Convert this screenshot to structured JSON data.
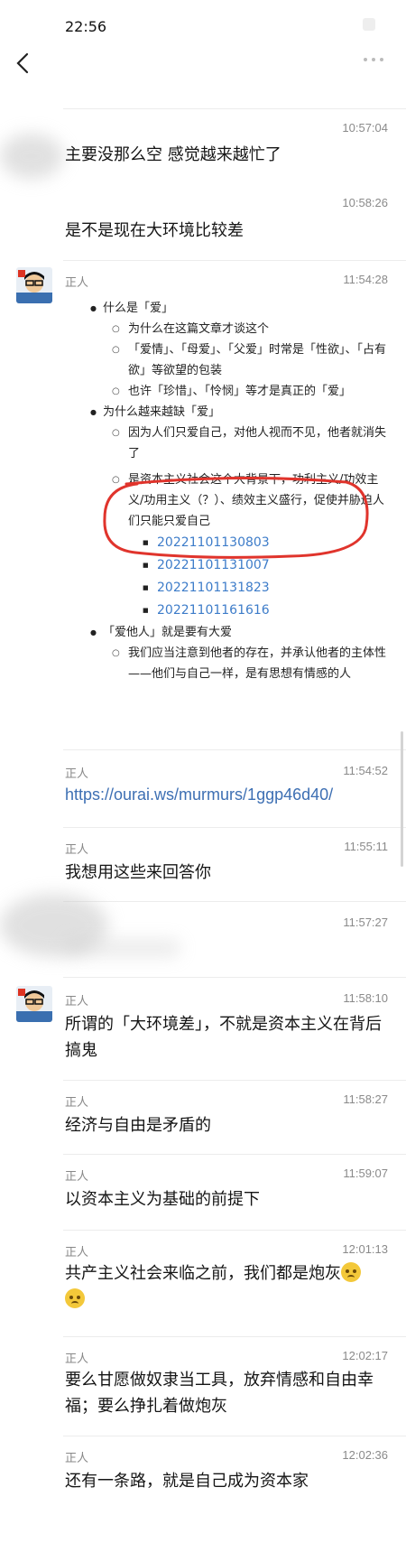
{
  "status_bar": {
    "time": "22:56"
  },
  "outline": {
    "s1": {
      "title": "什么是「爱」",
      "items": [
        "为什么在这篇文章才谈这个",
        "「爱情」、「母爱」、「父爱」时常是「性欲」、「占有欲」等欲望的包装",
        "也许「珍惜」、「怜悯」等才是真正的「爱」"
      ]
    },
    "s2": {
      "title": "为什么越来越缺「爱」",
      "items": [
        "因为人们只爱自己，对他人视而不见，他者就消失了",
        "是资本主义社会这个大背景下，功利主义/功效主义/功用主义（？）、绩效主义盛行，促使并胁迫人们只能只爱自己"
      ],
      "links": [
        "20221101130803",
        "20221101131007",
        "20221101131823",
        "20221101161616"
      ]
    },
    "s3": {
      "title": "「爱他人」就是要有大爱",
      "items": [
        "我们应当注意到他者的存在，并承认他者的主体性——他们与自己一样，是有思想有情感的人"
      ]
    }
  },
  "messages": [
    {
      "time": "10:57:04",
      "text": "主要没那么空 感觉越来越忙了"
    },
    {
      "time": "10:58:26",
      "text": "是不是现在大环境比较差"
    },
    {
      "time": "11:54:28",
      "sender": "正人"
    },
    {
      "time": "11:54:52",
      "sender": "正人",
      "text": "https://ourai.ws/murmurs/1ggp46d40/"
    },
    {
      "time": "11:55:11",
      "sender": "正人",
      "text": "我想用这些来回答你"
    },
    {
      "time": "11:57:27"
    },
    {
      "time": "11:58:10",
      "sender": "正人",
      "text": "所谓的「大环境差」，不就是资本主义在背后搞鬼"
    },
    {
      "time": "11:58:27",
      "sender": "正人",
      "text": "经济与自由是矛盾的"
    },
    {
      "time": "11:59:07",
      "sender": "正人",
      "text": "以资本主义为基础的前提下"
    },
    {
      "time": "12:01:13",
      "sender": "正人",
      "text": "共产主义社会来临之前，我们都是炮灰"
    },
    {
      "time": "12:02:17",
      "sender": "正人",
      "text": "要么甘愿做奴隶当工具，放弃情感和自由幸福；要么挣扎着做炮灰"
    },
    {
      "time": "12:02:36",
      "sender": "正人",
      "text": "还有一条路，就是自己成为资本家"
    }
  ]
}
